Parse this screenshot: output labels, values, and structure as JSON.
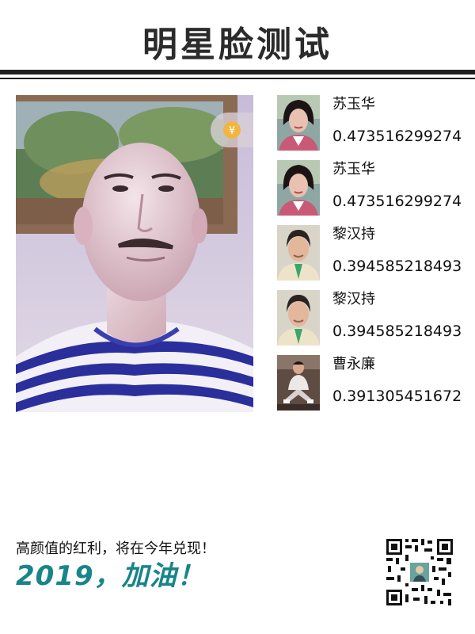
{
  "header": {
    "title": "明星脸测试"
  },
  "main_photo": {
    "icon": "portrait-photo",
    "badge_icon": "yen-coin-icon",
    "badge_symbol": "¥"
  },
  "results": [
    {
      "name": "苏玉华",
      "score": "0.473516299274",
      "icon": "portrait-thumbnail-woman"
    },
    {
      "name": "苏玉华",
      "score": "0.473516299274",
      "icon": "portrait-thumbnail-woman"
    },
    {
      "name": "黎汉持",
      "score": "0.394585218493",
      "icon": "portrait-thumbnail-man"
    },
    {
      "name": "黎汉持",
      "score": "0.394585218493",
      "icon": "portrait-thumbnail-man"
    },
    {
      "name": "曹永廉",
      "score": "0.391305451672",
      "icon": "portrait-thumbnail-man-seated"
    }
  ],
  "footer": {
    "tagline": "高颜值的红利，将在今年兑现！",
    "slogan": "2019，加油！",
    "qr_icon": "qr-code-icon"
  },
  "colors": {
    "accent": "#17858a",
    "title": "#2b2b2b",
    "rule": "#1f1f1f"
  }
}
